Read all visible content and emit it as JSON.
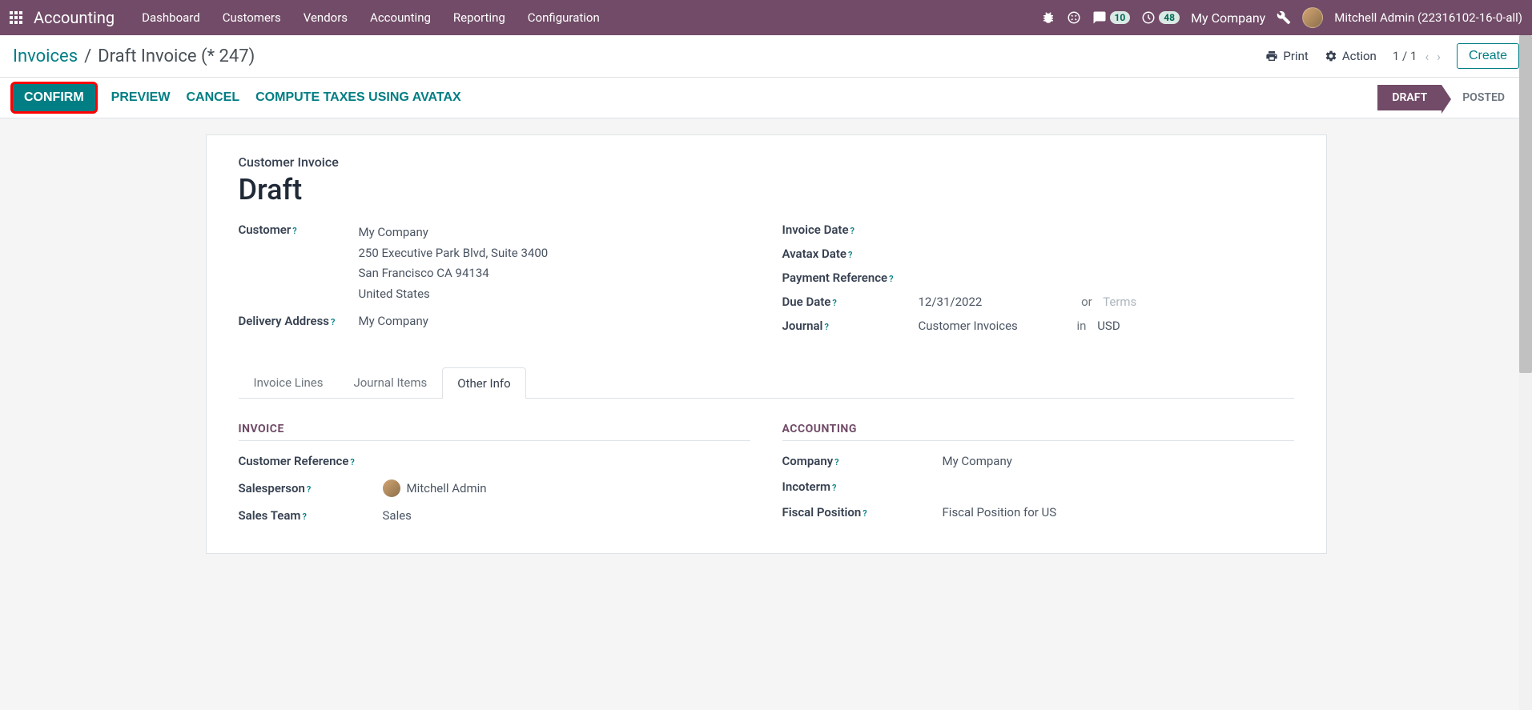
{
  "navbar": {
    "brand": "Accounting",
    "items": [
      "Dashboard",
      "Customers",
      "Vendors",
      "Accounting",
      "Reporting",
      "Configuration"
    ],
    "discuss_count": "10",
    "activity_count": "48",
    "company": "My Company",
    "user": "Mitchell Admin (22316102-16-0-all)"
  },
  "breadcrumb": {
    "root": "Invoices",
    "current": "Draft Invoice (* 247)"
  },
  "controls": {
    "print": "Print",
    "action": "Action",
    "pager": "1 / 1",
    "create": "Create"
  },
  "statusbar": {
    "confirm": "CONFIRM",
    "preview": "PREVIEW",
    "cancel": "CANCEL",
    "compute": "COMPUTE TAXES USING AVATAX",
    "draft": "DRAFT",
    "posted": "POSTED"
  },
  "form": {
    "title_label": "Customer Invoice",
    "title": "Draft",
    "customer_label": "Customer",
    "customer_name": "My Company",
    "customer_addr1": "250 Executive Park Blvd, Suite 3400",
    "customer_addr2": "San Francisco CA 94134",
    "customer_addr3": "United States",
    "delivery_label": "Delivery Address",
    "delivery_value": "My Company",
    "invoice_date_label": "Invoice Date",
    "avatax_date_label": "Avatax Date",
    "payment_ref_label": "Payment Reference",
    "due_date_label": "Due Date",
    "due_date_value": "12/31/2022",
    "or_label": "or",
    "terms_placeholder": "Terms",
    "journal_label": "Journal",
    "journal_value": "Customer Invoices",
    "in_label": "in",
    "currency": "USD"
  },
  "tabs": {
    "invoice_lines": "Invoice Lines",
    "journal_items": "Journal Items",
    "other_info": "Other Info"
  },
  "other_info": {
    "section_invoice": "INVOICE",
    "customer_ref_label": "Customer Reference",
    "salesperson_label": "Salesperson",
    "salesperson_value": "Mitchell Admin",
    "sales_team_label": "Sales Team",
    "sales_team_value": "Sales",
    "section_accounting": "ACCOUNTING",
    "company_label": "Company",
    "company_value": "My Company",
    "incoterm_label": "Incoterm",
    "fiscal_label": "Fiscal Position",
    "fiscal_value": "Fiscal Position for US"
  }
}
